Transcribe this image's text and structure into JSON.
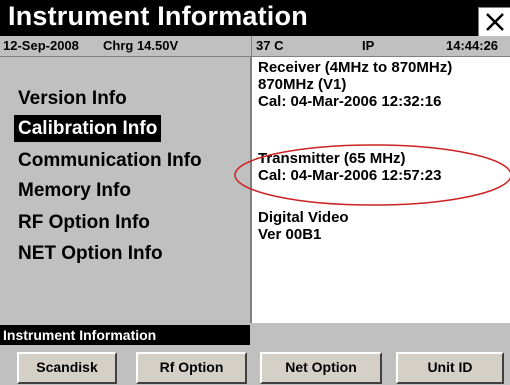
{
  "window": {
    "title": "Instrument Information"
  },
  "status": {
    "date": "12-Sep-2008",
    "charge": "Chrg 14.50V",
    "temperature": "37 C",
    "mode": "IP",
    "time": "14:44:26"
  },
  "menu": {
    "items": [
      {
        "label": "Version Info",
        "selected": false
      },
      {
        "label": "Calibration Info",
        "selected": true
      },
      {
        "label": "Communication Info",
        "selected": false
      },
      {
        "label": "Memory Info",
        "selected": false
      },
      {
        "label": "RF Option Info",
        "selected": false
      },
      {
        "label": "NET Option Info",
        "selected": false
      }
    ]
  },
  "info": {
    "receiver": {
      "line1": "Receiver (4MHz to 870MHz)",
      "line2": "870MHz (V1)",
      "cal": "Cal: 04-Mar-2006 12:32:16"
    },
    "transmitter": {
      "line1": "Transmitter (65 MHz)",
      "cal": "Cal: 04-Mar-2006 12:57:23"
    },
    "digital_video": {
      "line1": "Digital Video",
      "version": "Ver 00B1"
    }
  },
  "footer": {
    "section_label": "Instrument Information",
    "buttons": [
      "Scandisk",
      "Rf Option",
      "Net Option",
      "Unit ID"
    ]
  },
  "colors": {
    "highlight_ellipse": "#cc2222",
    "panel_gray": "#c0c0c0",
    "title_black": "#000000"
  }
}
